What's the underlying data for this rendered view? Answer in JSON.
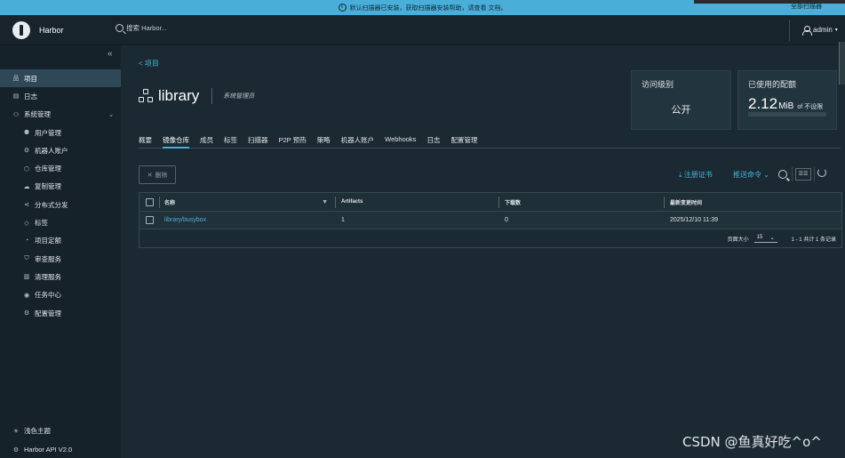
{
  "banner": {
    "message": "默认扫描器已安装，获取扫描器安装帮助，请查看 文档。",
    "scan_all": "全部扫描器"
  },
  "header": {
    "brand": "Harbor",
    "search_placeholder": "搜索 Harbor...",
    "user": "admin"
  },
  "sidebar": {
    "items": [
      {
        "label": "项目",
        "icon": "projects-icon"
      },
      {
        "label": "日志",
        "icon": "logs-icon"
      },
      {
        "label": "系统管理",
        "icon": "admin-icon"
      },
      {
        "label": "用户管理",
        "icon": "users-icon"
      },
      {
        "label": "机器人账户",
        "icon": "robot-icon"
      },
      {
        "label": "仓库管理",
        "icon": "registry-icon"
      },
      {
        "label": "复制管理",
        "icon": "replication-icon"
      },
      {
        "label": "分布式分发",
        "icon": "distribution-icon"
      },
      {
        "label": "标签",
        "icon": "tag-icon"
      },
      {
        "label": "项目定额",
        "icon": "quota-icon"
      },
      {
        "label": "审查服务",
        "icon": "shield-icon"
      },
      {
        "label": "清理服务",
        "icon": "trash-icon"
      },
      {
        "label": "任务中心",
        "icon": "task-icon"
      },
      {
        "label": "配置管理",
        "icon": "settings-icon"
      }
    ],
    "theme_label": "浅色主题",
    "api_label": "Harbor API V2.0"
  },
  "main": {
    "breadcrumb": "< 项目",
    "project_name": "library",
    "project_role": "系统管理员",
    "access_card": {
      "title": "访问级别",
      "value": "公开"
    },
    "quota_card": {
      "title": "已使用的配额",
      "value": "2.12",
      "unit": "MiB",
      "of": "of 不设限"
    },
    "tabs": [
      "概要",
      "镜像仓库",
      "成员",
      "标签",
      "扫描器",
      "P2P 预热",
      "策略",
      "机器人账户",
      "Webhooks",
      "日志",
      "配置管理"
    ],
    "active_tab": "镜像仓库",
    "toolbar": {
      "delete": "删除",
      "cert": "注册证书",
      "push": "推送命令"
    },
    "table": {
      "headers": [
        "名称",
        "Artifacts",
        "下载数",
        "最新变更时间"
      ],
      "rows": [
        {
          "name": "library/busybox",
          "artifacts": "1",
          "pulls": "0",
          "time": "2025/12/10 11:39"
        }
      ],
      "footer": {
        "page_size_label": "页面大小",
        "page_size": "15",
        "summary": "1 - 1 共计 1 条记录"
      }
    }
  },
  "watermark": "CSDN @鱼真好吃^o^"
}
